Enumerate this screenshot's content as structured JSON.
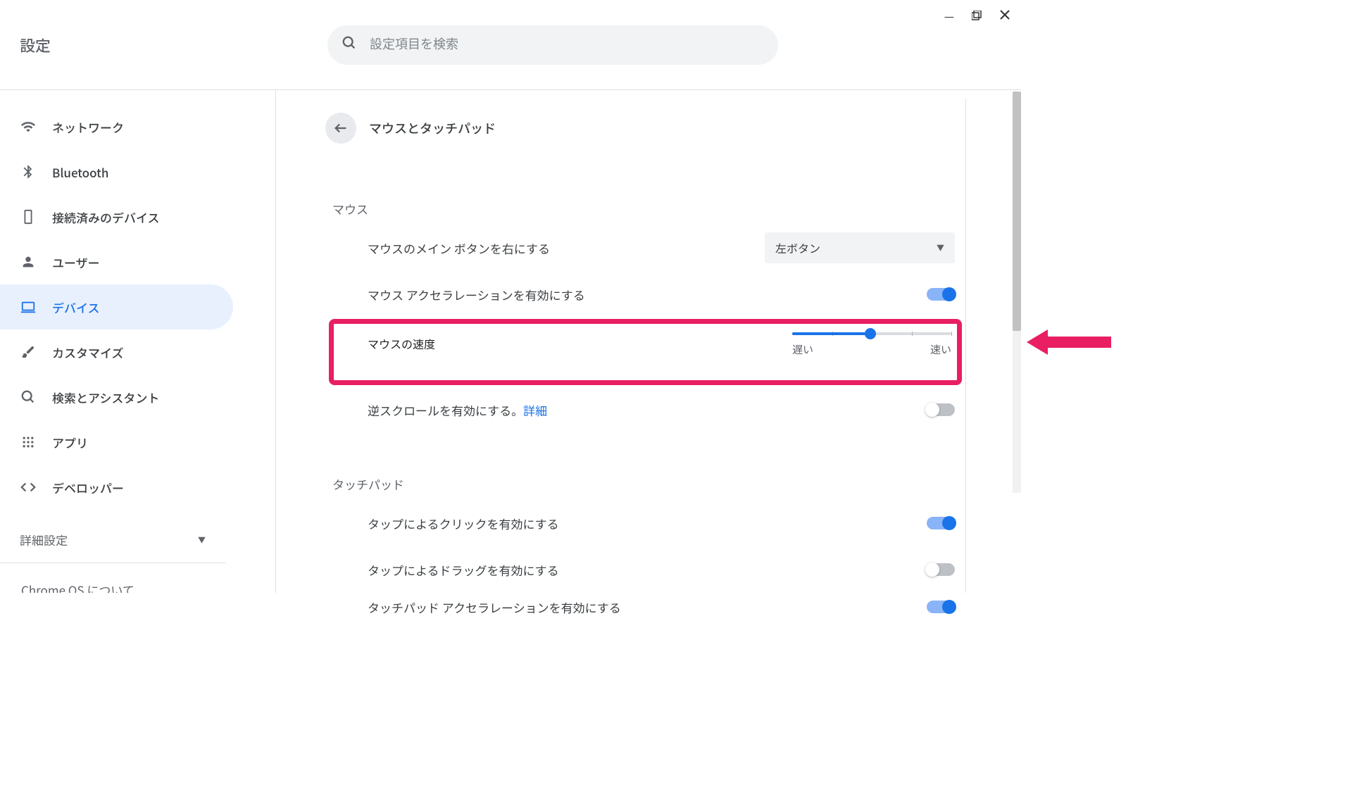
{
  "window": {
    "minimize": "—",
    "maximize": "❐",
    "close": "✕"
  },
  "header": {
    "app_name": "設定",
    "search_placeholder": "設定項目を検索"
  },
  "sidebar": {
    "items": [
      {
        "label": "ネットワーク",
        "icon": "wifi"
      },
      {
        "label": "Bluetooth",
        "icon": "bluetooth"
      },
      {
        "label": "接続済みのデバイス",
        "icon": "phone"
      },
      {
        "label": "ユーザー",
        "icon": "person"
      },
      {
        "label": "デバイス",
        "icon": "laptop"
      },
      {
        "label": "カスタマイズ",
        "icon": "brush"
      },
      {
        "label": "検索とアシスタント",
        "icon": "search"
      },
      {
        "label": "アプリ",
        "icon": "apps"
      },
      {
        "label": "デベロッパー",
        "icon": "code"
      }
    ],
    "advanced": "詳細設定",
    "about": "Chrome OS について"
  },
  "page": {
    "title": "マウスとタッチパッド",
    "sections": {
      "mouse": {
        "title": "マウス",
        "primary_button_label": "マウスのメイン ボタンを右にする",
        "primary_button_value": "左ボタン",
        "acceleration_label": "マウス アクセラレーションを有効にする",
        "acceleration_on": true,
        "speed_label": "マウスの速度",
        "speed_slow": "遅い",
        "speed_fast": "速い",
        "speed_value": 49,
        "reverse_scroll_label": "逆スクロールを有効にする。",
        "reverse_scroll_link": "詳細",
        "reverse_scroll_on": false
      },
      "touchpad": {
        "title": "タッチパッド",
        "tap_click_label": "タップによるクリックを有効にする",
        "tap_click_on": true,
        "tap_drag_label": "タップによるドラッグを有効にする",
        "tap_drag_on": false,
        "accel_label": "タッチパッド アクセラレーションを有効にする"
      }
    }
  }
}
